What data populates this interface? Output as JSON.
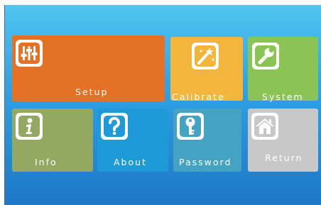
{
  "menu": {
    "tiles": [
      {
        "id": "setup",
        "label": "Setup",
        "color": "#e57126",
        "icon": "sliders-icon"
      },
      {
        "id": "calibrate",
        "label": "Calibrate",
        "color": "#f4b53d",
        "icon": "magic-wand-icon"
      },
      {
        "id": "system",
        "label": "System",
        "color": "#8bc455",
        "icon": "wrench-icon"
      },
      {
        "id": "info",
        "label": "Info",
        "color": "#93a860",
        "icon": "info-icon"
      },
      {
        "id": "about",
        "label": "About",
        "color": "#1f9ad8",
        "icon": "question-icon"
      },
      {
        "id": "password",
        "label": "Password",
        "color": "#44a2c2",
        "icon": "key-icon"
      },
      {
        "id": "return",
        "label": "Return",
        "color": "#c8c8c8",
        "icon": "home-icon"
      }
    ]
  }
}
